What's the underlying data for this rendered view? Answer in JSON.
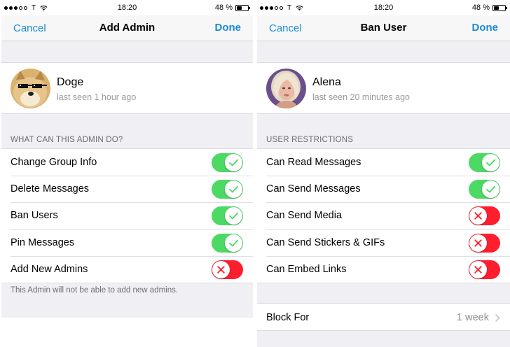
{
  "status_bar": {
    "carrier": "T",
    "time": "18:20",
    "battery_pct": "48 %",
    "battery_level": 0.48
  },
  "left": {
    "nav": {
      "cancel": "Cancel",
      "title": "Add Admin",
      "done": "Done"
    },
    "profile": {
      "name": "Doge",
      "last_seen": "last seen 1 hour ago"
    },
    "section_header": "WHAT CAN THIS ADMIN DO?",
    "rows": [
      {
        "label": "Change Group Info",
        "on": true
      },
      {
        "label": "Delete Messages",
        "on": true
      },
      {
        "label": "Ban Users",
        "on": true
      },
      {
        "label": "Pin Messages",
        "on": true
      },
      {
        "label": "Add New Admins",
        "on": false
      }
    ],
    "footer_note": "This Admin will not be able to add new admins."
  },
  "right": {
    "nav": {
      "cancel": "Cancel",
      "title": "Ban User",
      "done": "Done"
    },
    "profile": {
      "name": "Alena",
      "last_seen": "last seen 20 minutes ago"
    },
    "section_header": "USER RESTRICTIONS",
    "rows": [
      {
        "label": "Can Read Messages",
        "on": true
      },
      {
        "label": "Can Send Messages",
        "on": true
      },
      {
        "label": "Can Send Media",
        "on": false
      },
      {
        "label": "Can Send Stickers & GIFs",
        "on": false
      },
      {
        "label": "Can Embed Links",
        "on": false
      }
    ],
    "block_for": {
      "label": "Block For",
      "value": "1 week"
    }
  },
  "colors": {
    "accent": "#1a8ad8",
    "toggle_on": "#4cd964",
    "toggle_off": "#ff1e2d",
    "background": "#efeff4"
  },
  "icons": {
    "toggle_on": "checkmark-icon",
    "toggle_off": "x-icon",
    "disclosure": "chevron-right-icon"
  }
}
